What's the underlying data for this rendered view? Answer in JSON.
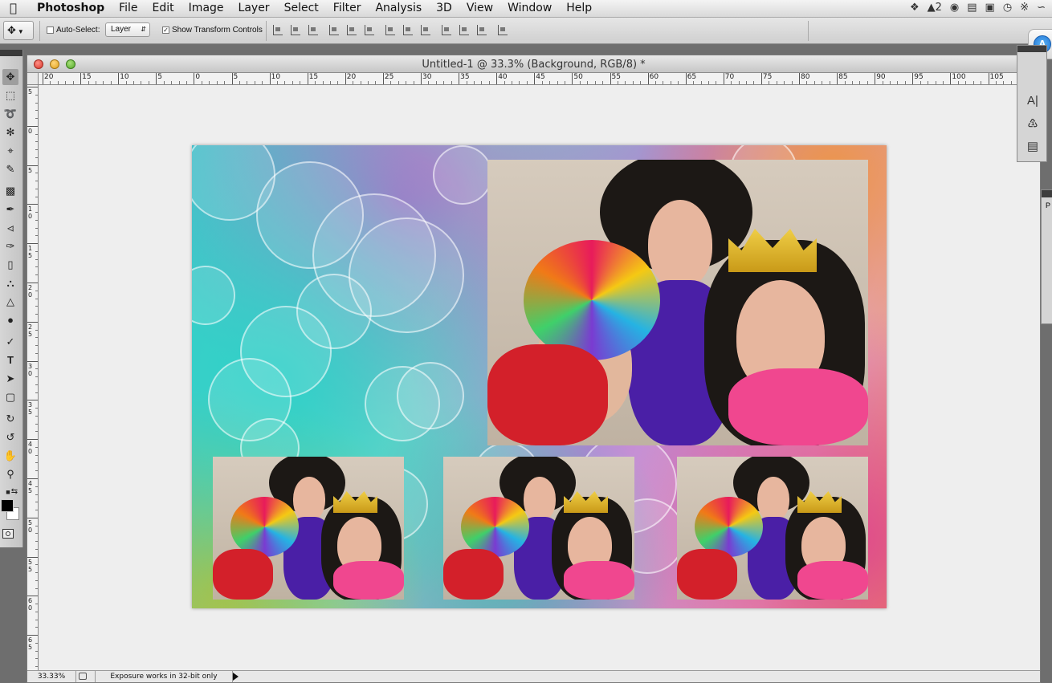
{
  "menubar": {
    "app_name": "Photoshop",
    "items": [
      "File",
      "Edit",
      "Image",
      "Layer",
      "Select",
      "Filter",
      "Analysis",
      "3D",
      "View",
      "Window",
      "Help"
    ],
    "status_items": [
      "dropbox-icon",
      "adobe-icon",
      "cloud-icon",
      "clipboard-icon",
      "finder-icon",
      "time-machine-icon",
      "bluetooth-icon",
      "wifi-icon"
    ],
    "adobe_badge": "2"
  },
  "options": {
    "auto_select_label": "Auto-Select:",
    "auto_select_checked": false,
    "target_value": "Layer",
    "show_transform_label": "Show Transform Controls",
    "show_transform_checked": true
  },
  "document": {
    "title": "Untitled-1 @ 33.3% (Background, RGB/8) *",
    "zoom": "33.33%",
    "status_message": "Exposure works in 32-bit only"
  },
  "hruler_labels": [
    "20",
    "15",
    "10",
    "5",
    "0",
    "5",
    "10",
    "15",
    "20",
    "25",
    "30",
    "35",
    "40",
    "45",
    "50",
    "55",
    "60",
    "65",
    "70",
    "75",
    "80",
    "85",
    "90",
    "95",
    "100",
    "105"
  ],
  "vruler_labels": [
    "5",
    "0",
    "5",
    "1 0",
    "1 5",
    "2 0",
    "2 5",
    "3 0",
    "3 5",
    "4 0",
    "4 5",
    "5 0",
    "5 5",
    "6 0",
    "6 5"
  ],
  "tools": [
    "move-tool",
    "marquee-tool",
    "lasso-tool",
    "quick-select-tool",
    "crop-tool",
    "eyedropper-tool",
    "spot-heal-tool",
    "brush-tool",
    "stamp-tool",
    "history-brush-tool",
    "eraser-tool",
    "paint-bucket-tool",
    "blur-tool",
    "dodge-tool",
    "pen-tool",
    "type-tool",
    "path-select-tool",
    "rectangle-tool",
    "3d-rotate-tool",
    "3d-orbit-tool",
    "hand-tool",
    "zoom-tool"
  ],
  "colors": {
    "foreground": "#000000",
    "background": "#ffffff"
  },
  "panel_right_label": "P"
}
